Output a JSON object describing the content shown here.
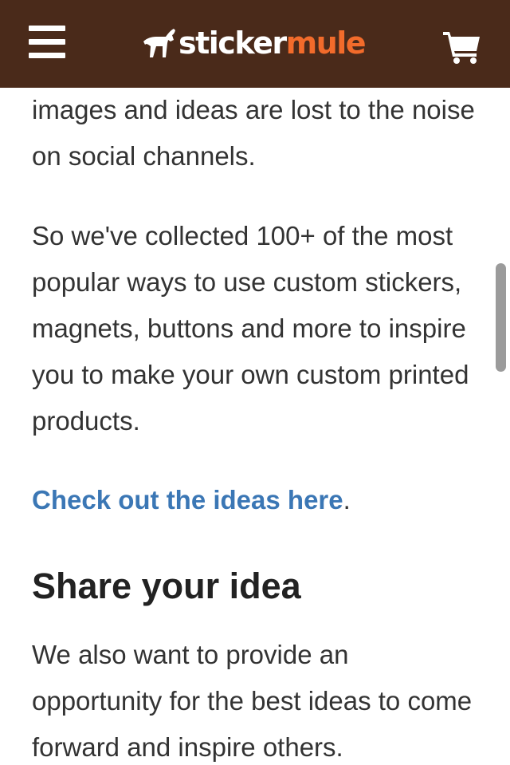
{
  "header": {
    "logo_text_1": "sticker",
    "logo_text_2": "mule",
    "colors": {
      "background": "#4a2a1a",
      "accent": "#f26b2b",
      "icon": "#ffffff"
    },
    "icons": {
      "menu": "hamburger-menu-icon",
      "logo": "mule-logo-icon",
      "cart": "shopping-cart-icon"
    }
  },
  "content": {
    "paragraph_1": "images and ideas are lost to the noise on social channels.",
    "paragraph_2": "So we've collected 100+ of the most popular ways to use custom stickers, magnets, buttons and more to inspire you to make your own custom printed products.",
    "link_text": "Check out the ideas here",
    "link_suffix": ".",
    "section_heading": "Share your idea",
    "paragraph_3": "We also want to provide an opportunity for the best ideas to come forward and inspire others.",
    "link_color": "#3b77b5"
  }
}
